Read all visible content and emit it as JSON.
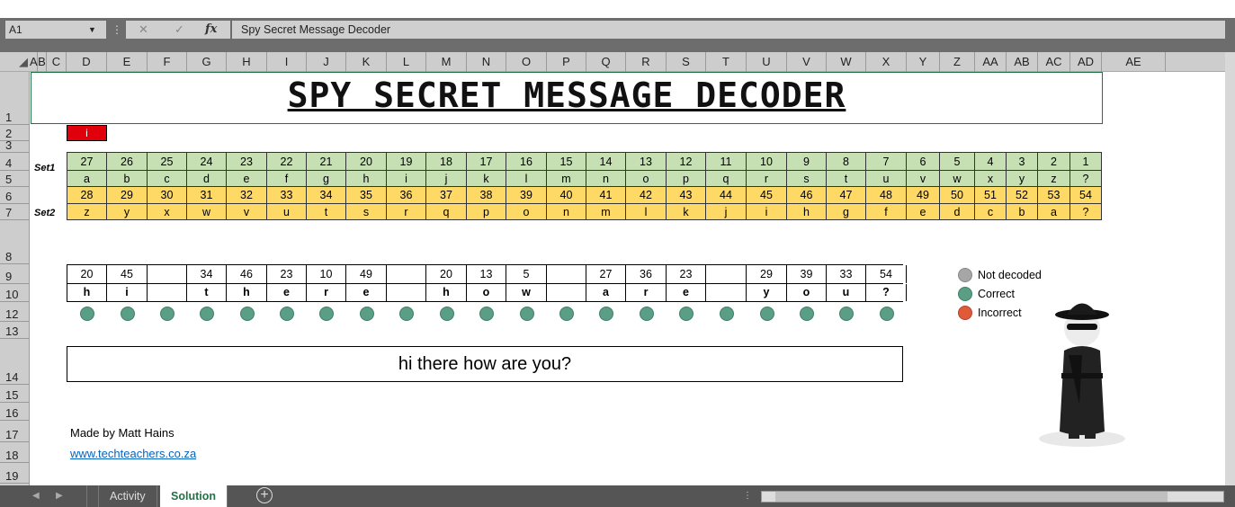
{
  "formula_bar": {
    "name_box": "A1",
    "formula": "Spy Secret Message Decoder",
    "cancel_icon": "✕",
    "enter_icon": "✓",
    "fx_label": "fx"
  },
  "columns": [
    "A",
    "B",
    "C",
    "D",
    "E",
    "F",
    "G",
    "H",
    "I",
    "J",
    "K",
    "L",
    "M",
    "N",
    "O",
    "P",
    "Q",
    "R",
    "S",
    "T",
    "U",
    "V",
    "W",
    "X",
    "Y",
    "Z",
    "AA",
    "AB",
    "AC",
    "AD",
    "AE"
  ],
  "rows": [
    "1",
    "2",
    "3",
    "4",
    "5",
    "6",
    "7",
    "8",
    "9",
    "10",
    "12",
    "13",
    "14",
    "15",
    "16",
    "17",
    "18",
    "19"
  ],
  "title": "SPY SECRET MESSAGE DECODER",
  "indicator": "i",
  "set1": {
    "label": "Set1",
    "numbers": [
      "27",
      "26",
      "25",
      "24",
      "23",
      "22",
      "21",
      "20",
      "19",
      "18",
      "17",
      "16",
      "15",
      "14",
      "13",
      "12",
      "11",
      "10",
      "9",
      "8",
      "7",
      "6",
      "5",
      "4",
      "3",
      "2",
      "1"
    ],
    "letters": [
      "a",
      "b",
      "c",
      "d",
      "e",
      "f",
      "g",
      "h",
      "i",
      "j",
      "k",
      "l",
      "m",
      "n",
      "o",
      "p",
      "q",
      "r",
      "s",
      "t",
      "u",
      "v",
      "w",
      "x",
      "y",
      "z",
      "?"
    ]
  },
  "set2": {
    "label": "Set2",
    "numbers": [
      "28",
      "29",
      "30",
      "31",
      "32",
      "33",
      "34",
      "35",
      "36",
      "37",
      "38",
      "39",
      "40",
      "41",
      "42",
      "43",
      "44",
      "45",
      "46",
      "47",
      "48",
      "49",
      "50",
      "51",
      "52",
      "53",
      "54"
    ],
    "letters": [
      "z",
      "y",
      "x",
      "w",
      "v",
      "u",
      "t",
      "s",
      "r",
      "q",
      "p",
      "o",
      "n",
      "m",
      "l",
      "k",
      "j",
      "i",
      "h",
      "g",
      "f",
      "e",
      "d",
      "c",
      "b",
      "a",
      "?"
    ]
  },
  "message": {
    "numbers": [
      "20",
      "45",
      "",
      "34",
      "46",
      "23",
      "10",
      "49",
      "",
      "20",
      "13",
      "5",
      "",
      "27",
      "36",
      "23",
      "",
      "29",
      "39",
      "33",
      "54"
    ],
    "letters": [
      "h",
      "i",
      "",
      "t",
      "h",
      "e",
      "r",
      "e",
      "",
      "h",
      "o",
      "w",
      "",
      "a",
      "r",
      "e",
      "",
      "y",
      "o",
      "u",
      "?"
    ]
  },
  "answer": "hi there how are you?",
  "legend": [
    {
      "label": "Not decoded",
      "color": "#a6a6a6"
    },
    {
      "label": "Correct",
      "color": "#5a9e85"
    },
    {
      "label": "Incorrect",
      "color": "#e05a3a"
    }
  ],
  "credit": "Made by Matt Hains",
  "link": "www.techteachers.co.za",
  "tabs": [
    {
      "label": "Activity"
    },
    {
      "label": "Solution"
    }
  ],
  "add_sheet": "+"
}
